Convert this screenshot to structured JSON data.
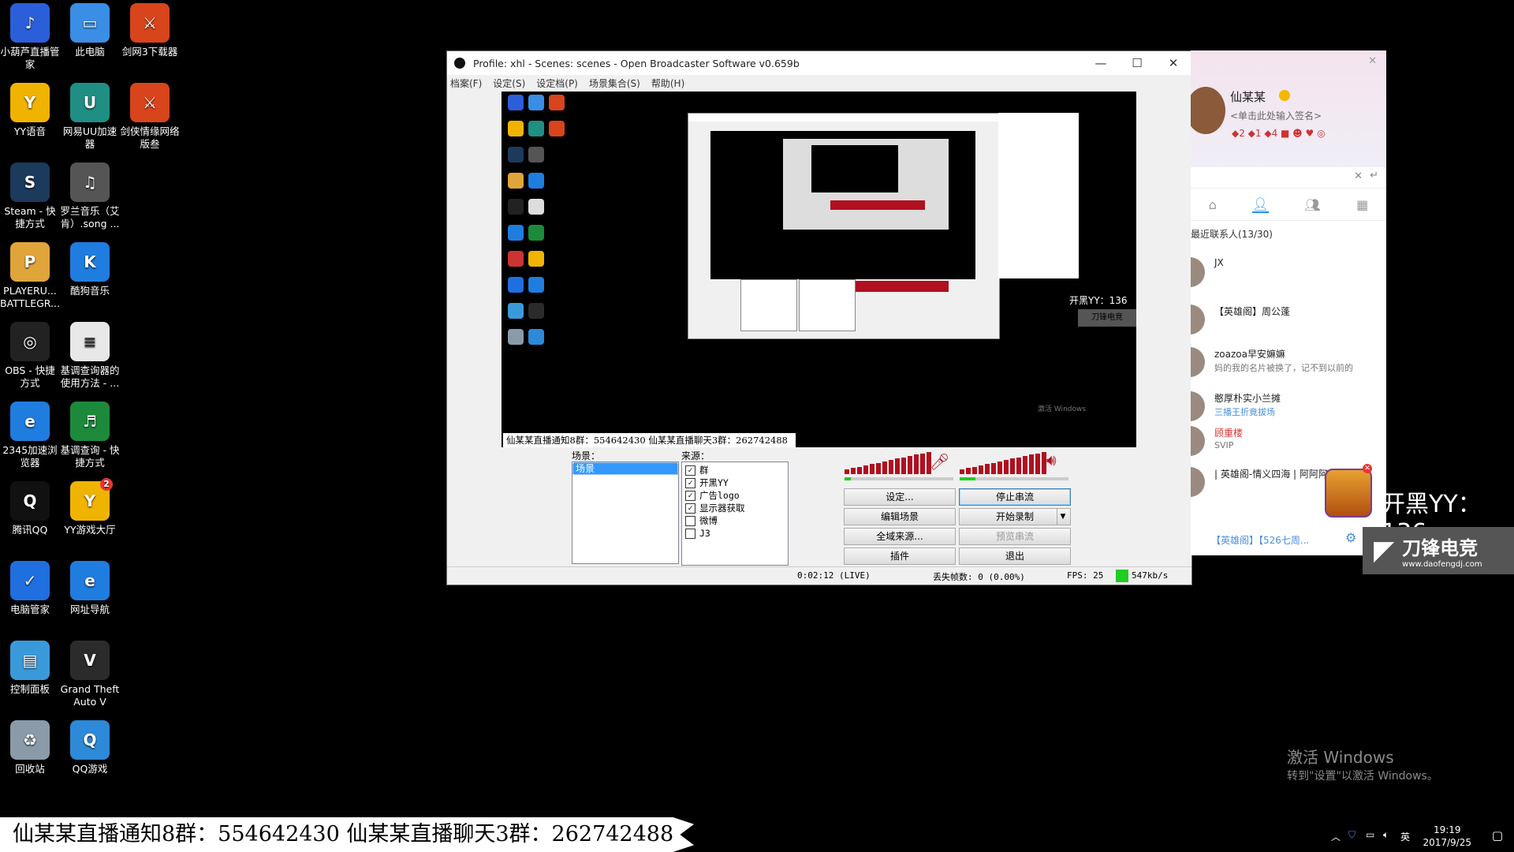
{
  "desktop": {
    "icons": [
      {
        "label": "小葫芦直播管家",
        "color": "#2b5fd9",
        "glyph": "♪",
        "icon": "hulu-icon"
      },
      {
        "label": "此电脑",
        "color": "#3a8ee6",
        "glyph": "▭",
        "icon": "computer-icon"
      },
      {
        "label": "剑网3下载器",
        "color": "#d8441c",
        "glyph": "⚔",
        "icon": "jx3-icon"
      },
      {
        "label": "YY语音",
        "color": "#f0b400",
        "glyph": "Y",
        "icon": "yy-icon"
      },
      {
        "label": "网易UU加速器",
        "color": "#1f8f84",
        "glyph": "U",
        "icon": "uu-icon"
      },
      {
        "label": "剑侠情缘网络版叁",
        "color": "#d8441c",
        "glyph": "⚔",
        "icon": "jx3-game-icon"
      },
      {
        "label": "Steam - 快捷方式",
        "color": "#1b3a5c",
        "glyph": "S",
        "icon": "steam-icon"
      },
      {
        "label": "罗兰音乐（艾肯）.song ...",
        "color": "#555555",
        "glyph": "♫",
        "icon": "music-file-icon"
      },
      {
        "label": "PLAYERU... BATTLEGR...",
        "color": "#e0a53a",
        "glyph": "P",
        "icon": "pubg-icon"
      },
      {
        "label": "酷狗音乐",
        "color": "#1f7de0",
        "glyph": "K",
        "icon": "kugou-icon"
      },
      {
        "label": "OBS - 快捷方式",
        "color": "#222222",
        "glyph": "◎",
        "icon": "obs-icon"
      },
      {
        "label": "基调查询器的使用方法 - ...",
        "color": "#e8e8e8",
        "glyph": "≡",
        "icon": "text-file-icon"
      },
      {
        "label": "2345加速浏览器",
        "color": "#1f7de0",
        "glyph": "e",
        "icon": "browser-icon"
      },
      {
        "label": "基调查询 - 快捷方式",
        "color": "#1c8a3a",
        "glyph": "♬",
        "icon": "key-query-icon"
      },
      {
        "label": "腾讯QQ",
        "color": "#111111",
        "glyph": "Q",
        "icon": "qq-icon"
      },
      {
        "label": "YY游戏大厅",
        "color": "#f0b400",
        "glyph": "Y",
        "icon": "yy-games-icon",
        "badge": "2"
      },
      {
        "label": "电脑管家",
        "color": "#1f6fe0",
        "glyph": "✓",
        "icon": "pc-manager-icon"
      },
      {
        "label": "网址导航",
        "color": "#1f7de0",
        "glyph": "e",
        "icon": "ie-icon"
      },
      {
        "label": "控制面板",
        "color": "#3a9ad9",
        "glyph": "▤",
        "icon": "control-panel-icon"
      },
      {
        "label": "Grand Theft Auto V",
        "color": "#2b2b2b",
        "glyph": "V",
        "icon": "gta-icon"
      },
      {
        "label": "回收站",
        "color": "#8a9aa8",
        "glyph": "♻",
        "icon": "recycle-bin-icon"
      },
      {
        "label": "QQ游戏",
        "color": "#2c8ad8",
        "glyph": "Q",
        "icon": "qq-games-icon"
      }
    ]
  },
  "obs": {
    "title": "Profile: xhl - Scenes: scenes - Open Broadcaster Software v0.659b",
    "menu": [
      "档案(F)",
      "设定(S)",
      "设定档(P)",
      "场景集合(S)",
      "帮助(H)"
    ],
    "preview_banner": "仙某某直播通知8群：554642430  仙某某直播聊天3群：262742488",
    "scenes_label": "场景：",
    "sources_label": "来源：",
    "scenes": [
      "场景"
    ],
    "sources": [
      {
        "label": "群",
        "checked": true
      },
      {
        "label": "开黑YY",
        "checked": true
      },
      {
        "label": "广告logo",
        "checked": true
      },
      {
        "label": "显示器获取",
        "checked": true
      },
      {
        "label": "微博",
        "checked": false
      },
      {
        "label": "J3",
        "checked": false
      }
    ],
    "buttons": {
      "settings": "设定...",
      "stop_stream": "停止串流",
      "edit_scene": "编辑场景",
      "start_record": "开始录制",
      "global_sources": "全域来源...",
      "preview_stream": "预览串流",
      "plugins": "插件",
      "exit": "退出"
    },
    "status": {
      "time": "0:02:12 (LIVE)",
      "dropped": "丢失帧数: 0 (0.00%)",
      "fps": "FPS: 25",
      "bitrate": "547kb/s",
      "bitrate_color": "#22cc22"
    }
  },
  "qq": {
    "name": "仙某某",
    "signature": "<单击此处输入签名>",
    "contacts_header": "最近联系人(13/30)",
    "contacts": [
      {
        "name": "JX",
        "msg": ""
      },
      {
        "name": "【英雄阁】周公蓬",
        "msg": ""
      },
      {
        "name": "zoazoa早安嫲嫲",
        "msg": "妈的我的名片被换了，记不到以前的"
      },
      {
        "name": "憨厚朴实小兰摊",
        "msg": "三播王折竟拔场"
      },
      {
        "name": "顾重楼",
        "msg": "SVIP"
      },
      {
        "name": "| 英雄阁-情义四海 | 阿阿阿",
        "msg": ""
      }
    ],
    "footer": "【英雄阁】【526七周..."
  },
  "overlay": {
    "yy_text": "开黑YY：136",
    "logo_text": "刀锋电竞",
    "logo_sub": "www.daofengdj.com"
  },
  "banner": "仙某某直播通知8群：554642430  仙某某直播聊天3群：262742488",
  "watermark": {
    "line1": "激活 Windows",
    "line2": "转到\"设置\"以激活 Windows。"
  },
  "tray": {
    "ime": "英",
    "time": "19:19",
    "date": "2017/9/25"
  }
}
